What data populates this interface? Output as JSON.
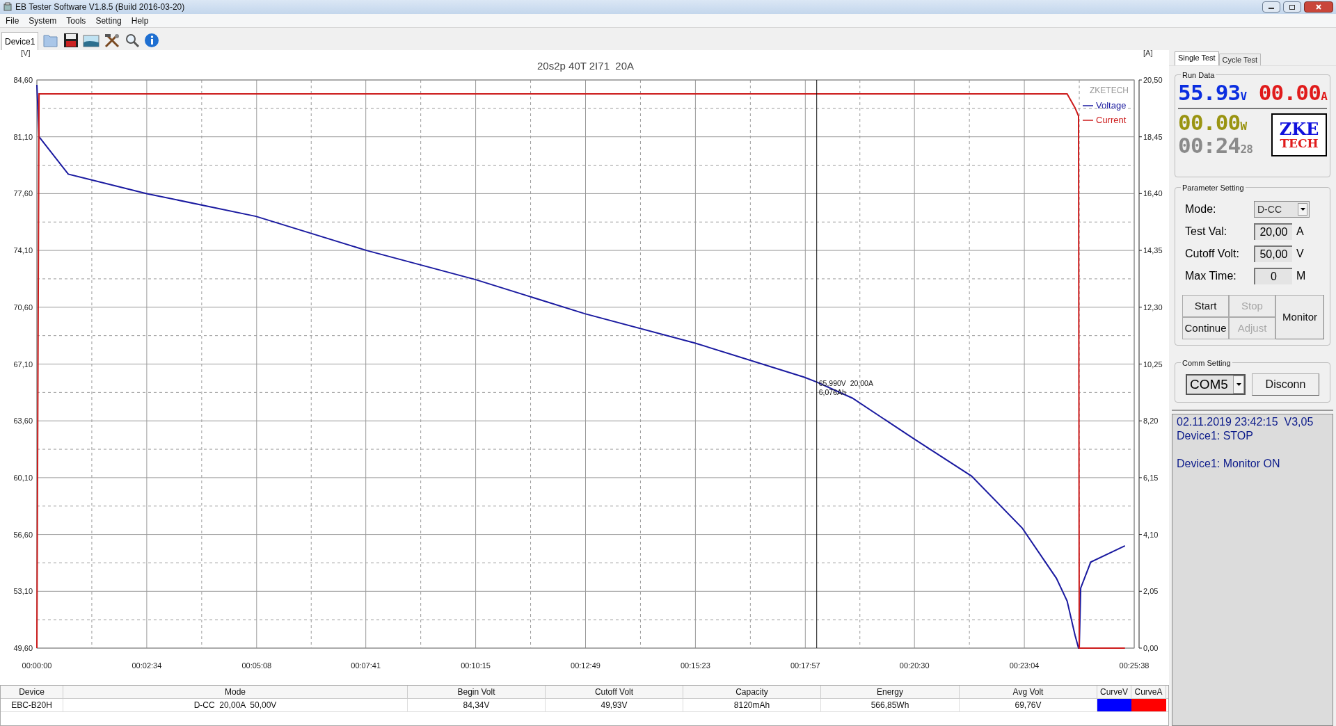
{
  "window": {
    "title": "EB Tester Software V1.8.5 (Build 2016-03-20)"
  },
  "menu": [
    "File",
    "System",
    "Tools",
    "Setting",
    "Help"
  ],
  "toolbar": {
    "device_tab": "Device1"
  },
  "chart": {
    "chart_data": {
      "type": "line",
      "title": "20s2p 40T 2I71  20A",
      "ylabel": "[V]",
      "y2label": "[A]",
      "legend_title": "ZKETECH",
      "x": [
        0,
        3,
        44,
        154,
        307,
        462,
        615,
        768,
        922,
        1075,
        1093,
        1143,
        1229,
        1310,
        1381,
        1429,
        1444,
        1455,
        1460,
        1461,
        1463,
        1477,
        1525
      ],
      "series": [
        {
          "name": "Voltage",
          "color": "#1a1aa0",
          "values": [
            84.3,
            81.1,
            78.8,
            77.6,
            76.2,
            74.1,
            72.3,
            70.2,
            68.4,
            66.3,
            65.99,
            65.0,
            62.5,
            60.2,
            57.0,
            53.9,
            52.5,
            50.4,
            49.6,
            49.6,
            53.3,
            54.9,
            55.9
          ]
        },
        {
          "name": "Current",
          "color": "#cc1b1b",
          "axis": "y2",
          "values": [
            0,
            20.0,
            20.0,
            20.0,
            20.0,
            20.0,
            20.0,
            20.0,
            20.0,
            20.0,
            20.0,
            20.0,
            20.0,
            20.0,
            20.0,
            20.0,
            20.0,
            19.5,
            19.2,
            0,
            0,
            0,
            0
          ]
        }
      ],
      "xlim": [
        0,
        1538
      ],
      "ylim": [
        49.6,
        84.6
      ],
      "y2lim": [
        0,
        20.5
      ],
      "xticks": [
        {
          "value": 0,
          "label": "00:00:00"
        },
        {
          "value": 154,
          "label": "00:02:34"
        },
        {
          "value": 308,
          "label": "00:05:08"
        },
        {
          "value": 461,
          "label": "00:07:41"
        },
        {
          "value": 615,
          "label": "00:10:15"
        },
        {
          "value": 769,
          "label": "00:12:49"
        },
        {
          "value": 923,
          "label": "00:15:23"
        },
        {
          "value": 1077,
          "label": "00:17:57"
        },
        {
          "value": 1230,
          "label": "00:20:30"
        },
        {
          "value": 1384,
          "label": "00:23:04"
        },
        {
          "value": 1538,
          "label": "00:25:38"
        }
      ],
      "yticks": [
        {
          "value": 49.6,
          "label": "49,60"
        },
        {
          "value": 53.1,
          "label": "53,10"
        },
        {
          "value": 56.6,
          "label": "56,60"
        },
        {
          "value": 60.1,
          "label": "60,10"
        },
        {
          "value": 63.6,
          "label": "63,60"
        },
        {
          "value": 67.1,
          "label": "67,10"
        },
        {
          "value": 70.6,
          "label": "70,60"
        },
        {
          "value": 74.1,
          "label": "74,10"
        },
        {
          "value": 77.6,
          "label": "77,60"
        },
        {
          "value": 81.1,
          "label": "81,10"
        },
        {
          "value": 84.6,
          "label": "84,60"
        }
      ],
      "y2ticks": [
        {
          "value": 0,
          "label": "0,00"
        },
        {
          "value": 2.05,
          "label": "2,05"
        },
        {
          "value": 4.1,
          "label": "4,10"
        },
        {
          "value": 6.15,
          "label": "6,15"
        },
        {
          "value": 8.2,
          "label": "8,20"
        },
        {
          "value": 10.25,
          "label": "10,25"
        },
        {
          "value": 12.3,
          "label": "12,30"
        },
        {
          "value": 14.35,
          "label": "14,35"
        },
        {
          "value": 16.4,
          "label": "16,40"
        },
        {
          "value": 18.45,
          "label": "18,45"
        },
        {
          "value": 20.5,
          "label": "20,50"
        }
      ],
      "grid": true,
      "legend": true,
      "ref_lines": [
        {
          "axis": "x",
          "value": 1093
        }
      ],
      "annotations": [
        {
          "x": 1093,
          "y": 65.99,
          "text": "65,990V  20,00A"
        },
        {
          "x": 1093,
          "y": 65.99,
          "text": "6,076Ah"
        }
      ]
    }
  },
  "table": {
    "columns": [
      "Device",
      "Mode",
      "Begin Volt",
      "Cutoff Volt",
      "Capacity",
      "Energy",
      "Avg Volt",
      "CurveV",
      "CurveA"
    ],
    "rows": [
      {
        "cells": [
          "EBC-B20H",
          "D-CC  20,00A  50,00V",
          "84,34V",
          "49,93V",
          "8120mAh",
          "566,85Wh",
          "69,76V"
        ],
        "curve_swatches": [
          {
            "color": "#0000ff"
          },
          {
            "color": "#ff0000"
          }
        ]
      }
    ]
  },
  "side_panel": {
    "tabs": [
      {
        "label": "Single Test",
        "selected": true
      },
      {
        "label": "Cycle Test",
        "selected": false
      }
    ],
    "run_data": {
      "title": "Run Data",
      "voltage": "55.93",
      "voltage_unit": "V",
      "current": "00.00",
      "current_unit": "A",
      "power": "00.00",
      "power_unit": "W",
      "time": "00:24",
      "seconds": "28",
      "logo_top": "ZKE",
      "logo_bottom": "TECH"
    },
    "parameters": {
      "title": "Parameter Setting",
      "rows": [
        {
          "kind": "select",
          "label": "Mode:",
          "value": "D-CC"
        },
        {
          "kind": "input",
          "label": "Test Val:",
          "value": "20,00",
          "unit": "A"
        },
        {
          "kind": "input",
          "label": "Cutoff Volt:",
          "value": "50,00",
          "unit": "V"
        },
        {
          "kind": "input",
          "label": "Max Time:",
          "value": "0",
          "unit": "M"
        }
      ],
      "buttons": [
        {
          "label": "Start",
          "disabled": false
        },
        {
          "label": "Stop",
          "disabled": true
        },
        {
          "label": "Continue",
          "disabled": false
        },
        {
          "label": "Adjust",
          "disabled": true
        }
      ],
      "monitor_button": "Monitor"
    },
    "comm": {
      "title": "Comm Setting",
      "port": "COM5",
      "button": "Disconn"
    },
    "log": [
      [
        "02.11.2019 23:42:15  V3,05",
        "Device1: STOP"
      ],
      [
        "Device1: Monitor ON"
      ]
    ]
  }
}
